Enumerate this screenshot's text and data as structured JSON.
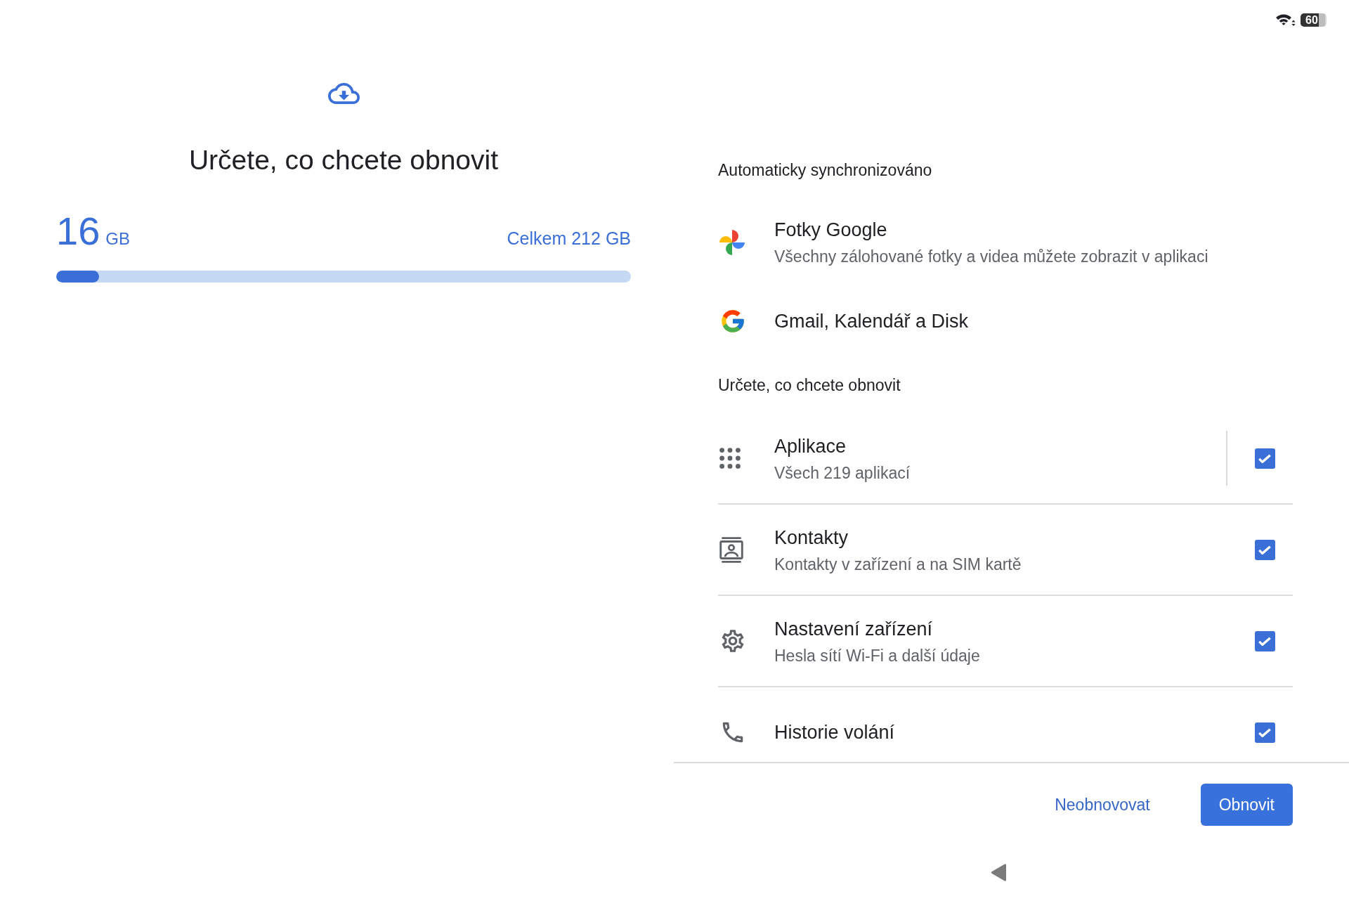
{
  "status_bar": {
    "battery": "60"
  },
  "header": {
    "title": "Určete, co chcete obnovit"
  },
  "storage": {
    "amount": "16",
    "unit": "GB",
    "total": "Celkem 212 GB",
    "level": 0.075
  },
  "synced_section": {
    "heading": "Automaticky synchronizováno",
    "items": [
      {
        "kind": "photos",
        "title": "Fotky Google",
        "subtitle": "Všechny zálohované fotky a videa můžete zobrazit v aplikaci"
      },
      {
        "kind": "google",
        "title": "Gmail, Kalendář a Disk"
      }
    ]
  },
  "restore_section": {
    "heading": "Určete, co chcete obnovit",
    "items": [
      {
        "kind": "apps",
        "title": "Aplikace",
        "subtitle": "Všech 219 aplikací",
        "checked": true,
        "expandable": true
      },
      {
        "kind": "contacts",
        "title": "Kontakty",
        "subtitle": "Kontakty v zařízení a na SIM kartě",
        "checked": true,
        "expandable": false
      },
      {
        "kind": "settings",
        "title": "Nastavení zařízení",
        "subtitle": "Hesla sítí Wi-Fi a další údaje",
        "checked": true,
        "expandable": false
      },
      {
        "kind": "calls",
        "title": "Historie volání",
        "checked": true,
        "expandable": false
      }
    ]
  },
  "buttons": [
    {
      "kind": "text",
      "label": "Neobnovovat"
    },
    {
      "kind": "filled",
      "label": "Obnovit"
    }
  ]
}
